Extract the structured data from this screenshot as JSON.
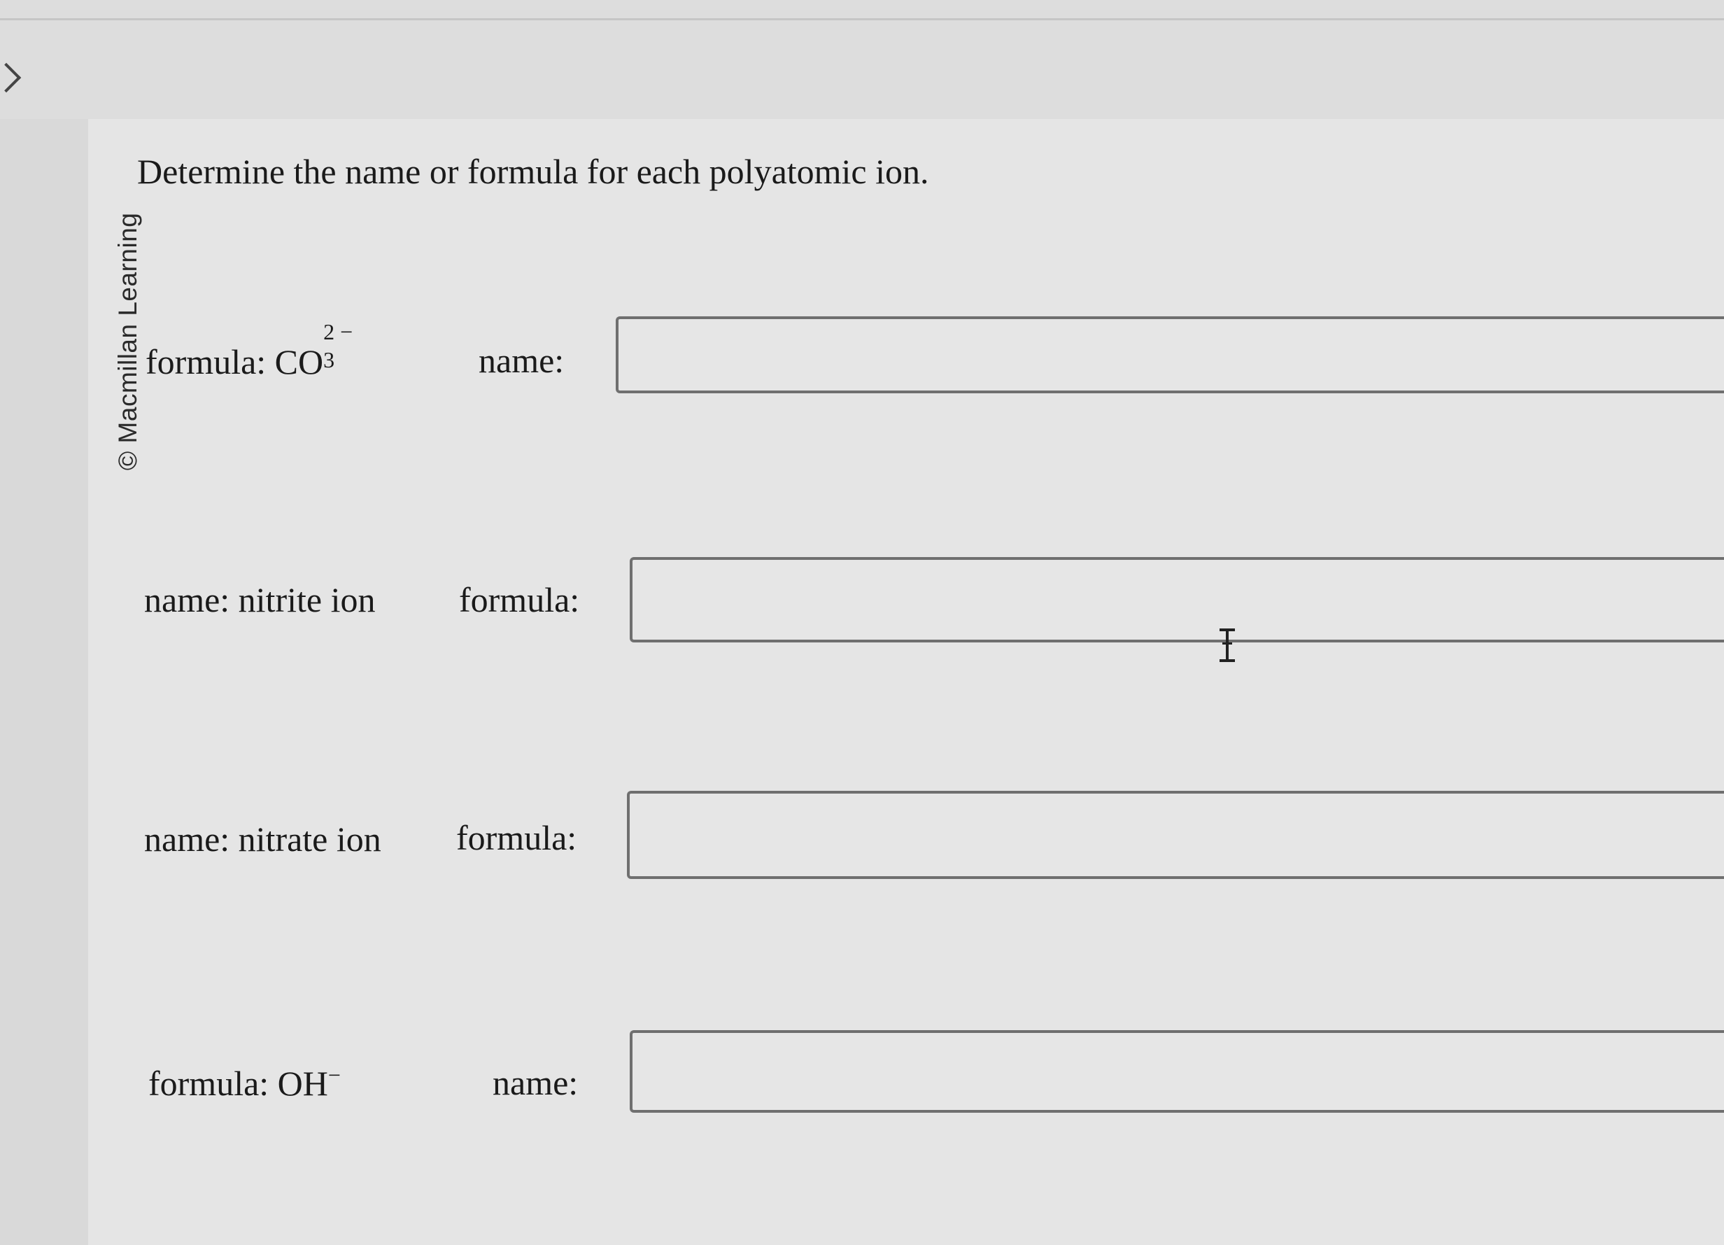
{
  "copyright": "© Macmillan Learning",
  "instruction": "Determine the name or formula for each polyatomic ion.",
  "questions": [
    {
      "given_prefix": "formula: ",
      "given_formula_base": "CO",
      "given_formula_sub": "3",
      "given_formula_sup": "2 −",
      "ask_label": "name:",
      "answer_value": ""
    },
    {
      "given_text": "name: nitrite ion",
      "ask_label": "formula:",
      "answer_value": ""
    },
    {
      "given_text": "name: nitrate ion",
      "ask_label": "formula:",
      "answer_value": ""
    },
    {
      "given_prefix": "formula: ",
      "given_formula_base": "OH",
      "given_formula_sup": "−",
      "ask_label": "name:",
      "answer_value": ""
    }
  ],
  "cursor_icon": "text-cursor-icon"
}
